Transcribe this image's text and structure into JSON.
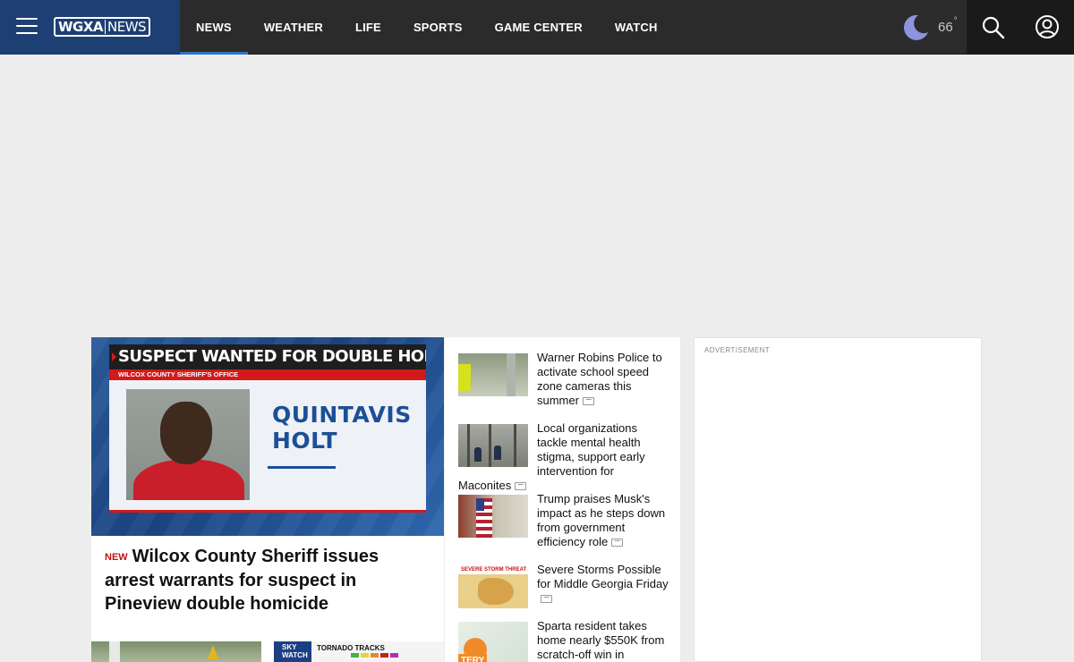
{
  "header": {
    "logo_call": "WGXA",
    "logo_news": "NEWS",
    "nav": [
      {
        "label": "NEWS",
        "active": true
      },
      {
        "label": "WEATHER",
        "active": false
      },
      {
        "label": "LIFE",
        "active": false
      },
      {
        "label": "SPORTS",
        "active": false
      },
      {
        "label": "GAME CENTER",
        "active": false
      },
      {
        "label": "WATCH",
        "active": false
      }
    ],
    "weather": {
      "icon": "moon-icon",
      "temp": "66",
      "degree": "°"
    },
    "accent_color": "#2e74c9",
    "brand_color": "#1d3f73"
  },
  "lead": {
    "image_banner": "SUSPECT WANTED FOR DOUBLE HOMICIDE",
    "image_subbar": "WILCOX COUNTY SHERIFF'S OFFICE",
    "image_name_line1": "QUINTAVIS",
    "image_name_line2": "HOLT",
    "badge": "NEW",
    "headline": "Wilcox County Sheriff issues arrest warrants for suspect in Pineview double homicide"
  },
  "below_thumbs": {
    "right_brand_line1": "SKY",
    "right_brand_line2": "WATCH",
    "right_title": "TORNADO TRACKS"
  },
  "stories": [
    {
      "title": "Warner Robins Police to activate school speed zone cameras this summer",
      "has_gallery": true
    },
    {
      "title": "Local organizations tackle mental health stigma, support early intervention for Maconites",
      "has_gallery": true
    },
    {
      "title": "Trump praises Musk's impact as he steps down from government efficiency role",
      "has_gallery": true
    },
    {
      "title": "Severe Storms Possible for Middle Georgia Friday",
      "has_gallery": true
    },
    {
      "title": "Sparta resident takes home nearly $550K from scratch-off win in",
      "has_gallery": false
    }
  ],
  "story_thumb_text": {
    "storm_header": "SEVERE STORM THREAT LE",
    "lottery": "TERY"
  },
  "ad": {
    "label": "ADVERTISEMENT"
  }
}
